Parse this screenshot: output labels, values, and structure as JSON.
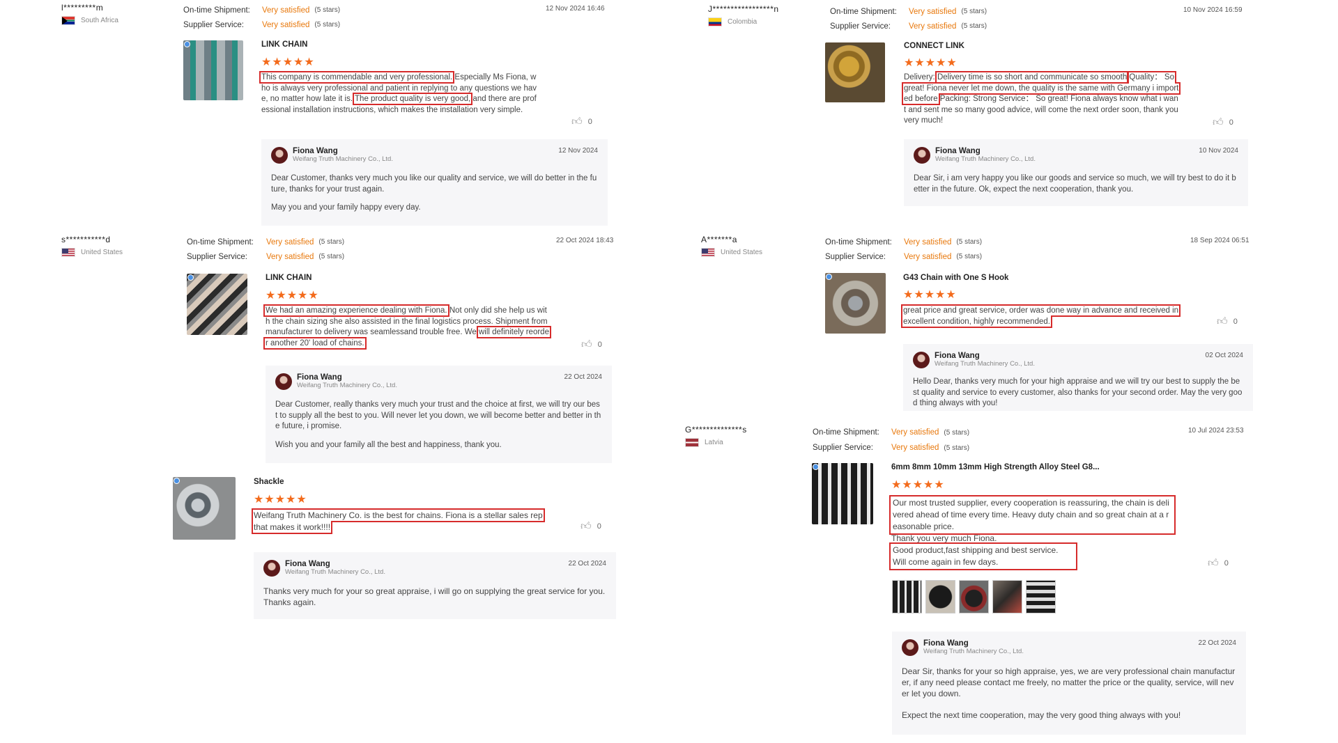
{
  "labels": {
    "ontime": "On-time Shipment:",
    "supplier": "Supplier Service:",
    "satisfied": "Very satisfied",
    "stars": "(5 stars)",
    "rating_glyphs": "★★★★★",
    "company": "Weifang Truth Machinery Co., Ltd."
  },
  "reviews": [
    {
      "user": "l*********m",
      "country": "South Africa",
      "date": "12 Nov 2024 16:46",
      "product": "LINK CHAIN",
      "likes": "0",
      "comment": [
        {
          "t": "This company is commendable and very professional.",
          "hl": true
        },
        {
          "t": " Especially Ms Fiona, who is always very professional and patient in replying to any questions we have, no matter how late it is. ",
          "hl": false
        },
        {
          "t": "The product quality is very good,",
          "hl": true
        },
        {
          "t": " and there are professional installation instructions, which makes the installation very simple.",
          "hl": false
        }
      ],
      "reply": {
        "name": "Fiona Wang",
        "date": "12 Nov 2024",
        "text1": "Dear Customer, thanks very much you like our quality and service, we will do better in the future, thanks for your trust again.",
        "text2": "May you and your family happy every day."
      }
    },
    {
      "user": "J*****************n",
      "country": "Colombia",
      "date": "10 Nov 2024 16:59",
      "product": "CONNECT LINK",
      "likes": "0",
      "comment": [
        {
          "t": "Delivery:  ",
          "hl": false
        },
        {
          "t": "Delivery time is so short and communicate so smooth",
          "hl": true
        },
        {
          "t": " ",
          "hl": false
        },
        {
          "t": "Quality：  So great! Fiona never let me down, the quality is the same with Germany i imported before",
          "hl": true
        },
        {
          "t": " Packing: Strong Service：  So great! Fiona always know what i want and sent me so many good advice, will come the next order soon, thank you very much!",
          "hl": false
        }
      ],
      "reply": {
        "name": "Fiona Wang",
        "date": "10 Nov 2024",
        "text1": "Dear Sir, i am very happy you like our goods and service so much, we will try best to do it better in the future. Ok, expect the next cooperation, thank you.",
        "text2": ""
      }
    },
    {
      "user": "s***********d",
      "country": "United States",
      "date": "22 Oct 2024 18:43",
      "product": "LINK CHAIN",
      "likes": "0",
      "comment": [
        {
          "t": "We had an amazing experience dealing with Fiona.",
          "hl": true
        },
        {
          "t": " Not only did she help us with the chain sizing she also assisted in the final logistics process. Shipment from manufacturer to delivery was seamlessand trouble free. We ",
          "hl": false
        },
        {
          "t": "will definitely reorder another 20' load of chains.",
          "hl": true
        }
      ],
      "reply": {
        "name": "Fiona Wang",
        "date": "22 Oct 2024",
        "text1": "Dear Customer, really thanks very much your trust and the choice at first, we will try our best to supply all the best to you. Will never let you down, we will become better and better in the future, i promise.",
        "text2": "Wish you and your family all the best and happiness, thank you."
      }
    },
    {
      "user": "A*******a",
      "country": "United States",
      "date": "18 Sep 2024 06:51",
      "product": "G43 Chain with One S Hook",
      "likes": "0",
      "comment": [
        {
          "t": "great price and great service, order was done way in advance and received in excellent condition, highly recommended.",
          "hl": true
        }
      ],
      "reply": {
        "name": "Fiona Wang",
        "date": "02 Oct 2024",
        "text1": "Hello Dear, thanks very much for your high appraise and we will try our best to supply the best quality and service to every customer, also thanks for your second order. May the very good thing always with you!",
        "text2": ""
      }
    },
    {
      "user": "",
      "country": "",
      "date": "",
      "product": "Shackle",
      "likes": "0",
      "comment": [
        {
          "t": "Weifang Truth Machinery Co. is the best for chains. Fiona is a stellar sales rep that makes it work!!!!",
          "hl": true
        }
      ],
      "reply": {
        "name": "Fiona Wang",
        "date": "22 Oct 2024",
        "text1": "Thanks very much for your so great appraise, i will go on supplying the great service for you. Thanks again.",
        "text2": ""
      }
    },
    {
      "user": "G**************s",
      "country": "Latvia",
      "date": "10 Jul 2024 23:53",
      "product": "6mm 8mm 10mm 13mm High Strength Alloy Steel G8...",
      "likes": "0",
      "comment_a": "Our most trusted supplier, every cooperation is reassuring, the chain is delivered ahead of time every time. Heavy duty chain and so great chain at a reasonable price.",
      "comment_b": "Thank you very much Fiona.",
      "comment_c": "Good product,fast shipping and best service.",
      "comment_d": "Will come again in few days.",
      "reply": {
        "name": "Fiona Wang",
        "date": "22 Oct 2024",
        "text1": "Dear Sir, thanks for your so high appraise, yes, we are very professional chain manufacturer, if any need please contact me freely, no matter the price or the quality, service, will never let you down.",
        "text2": "Expect the next time cooperation, may the very good thing always with you!"
      }
    }
  ]
}
